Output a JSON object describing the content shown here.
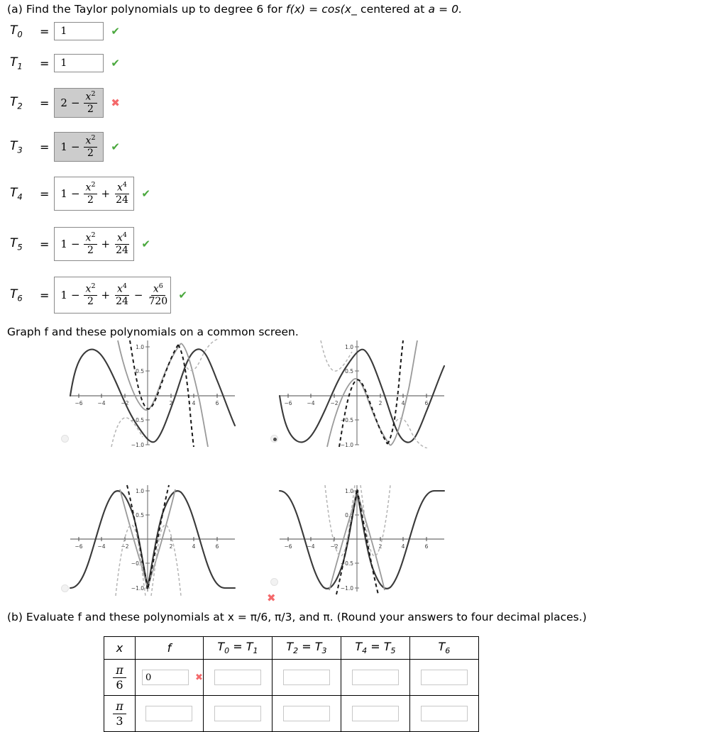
{
  "part_a": {
    "prompt": "(a) Find the Taylor polynomials up to degree 6 for  f(x) = cos(x_  centered at  a = 0.",
    "prompt_pieces": {
      "lead": "(a) Find the Taylor polynomials up to degree 6 for",
      "func": "f(x) = cos(x_",
      "center": "centered at",
      "a_value": "a = 0."
    },
    "rows": [
      {
        "label": "T",
        "sub": "0",
        "eq": "=",
        "value": "1",
        "kind": "plain",
        "box_state": "white",
        "mark": "correct",
        "mark_glyph": "✔"
      },
      {
        "label": "T",
        "sub": "1",
        "eq": "=",
        "value": "1",
        "kind": "plain",
        "box_state": "white",
        "mark": "correct",
        "mark_glyph": "✔"
      },
      {
        "label": "T",
        "sub": "2",
        "eq": "=",
        "value": "2 - x^2/2",
        "kind": "expr2",
        "lead_const": "2",
        "box_state": "gray",
        "mark": "incorrect",
        "mark_glyph": "✖"
      },
      {
        "label": "T",
        "sub": "3",
        "eq": "=",
        "value": "1 - x^2/2",
        "kind": "expr2",
        "lead_const": "1",
        "box_state": "gray",
        "mark": "correct",
        "mark_glyph": "✔"
      },
      {
        "label": "T",
        "sub": "4",
        "eq": "=",
        "value": "1 - x^2/2 + x^4/24",
        "kind": "expr4",
        "lead_const": "1",
        "box_state": "white",
        "mark": "correct",
        "mark_glyph": "✔"
      },
      {
        "label": "T",
        "sub": "5",
        "eq": "=",
        "value": "1 - x^2/2 + x^4/24",
        "kind": "expr4",
        "lead_const": "1",
        "box_state": "white",
        "mark": "correct",
        "mark_glyph": "✔"
      },
      {
        "label": "T",
        "sub": "6",
        "eq": "=",
        "value": "1 - x^2/2 + x^4/24 - x^6/720",
        "kind": "expr6",
        "lead_const": "1",
        "box_state": "white",
        "mark": "correct",
        "mark_glyph": "✔"
      }
    ],
    "terms": {
      "minus": "−",
      "plus": "+",
      "x": "x",
      "exp2": "2",
      "exp4": "4",
      "exp6": "6",
      "den2": "2",
      "den24": "24",
      "den720": "720"
    }
  },
  "graph_section": {
    "instruction": "Graph f and these polynomials on a common screen.",
    "options": [
      {
        "id": "graph-option-1",
        "selected": false,
        "mark": null,
        "curve": "sine"
      },
      {
        "id": "graph-option-2",
        "selected": true,
        "mark": null,
        "curve": "neg-sine"
      },
      {
        "id": "graph-option-3",
        "selected": false,
        "mark": null,
        "curve": "neg-cos-inverted"
      },
      {
        "id": "graph-option-4",
        "selected": false,
        "mark": "incorrect",
        "mark_glyph": "✖",
        "curve": "cos-shifted"
      }
    ],
    "axis": {
      "x_ticks": [
        "−6",
        "−4",
        "−2",
        "2",
        "4",
        "6"
      ],
      "y_ticks": [
        "1.0",
        "0.5",
        "−0.5",
        "−1.0"
      ],
      "xlim": [
        -6.6,
        6.6
      ],
      "ylim": [
        -1.15,
        1.15
      ]
    }
  },
  "part_b": {
    "prompt": "(b) Evaluate f and these polynomials at  x = π/6, π/3,  and π. (Round your answers to four decimal places.)",
    "table": {
      "headers": [
        {
          "text": "x",
          "sub": ""
        },
        {
          "text": "f",
          "sub": ""
        },
        {
          "text": "T",
          "sub": "0",
          "text2": " = T",
          "sub2": "1"
        },
        {
          "text": "T",
          "sub": "2",
          "text2": " = T",
          "sub2": "3"
        },
        {
          "text": "T",
          "sub": "4",
          "text2": " = T",
          "sub2": "5"
        },
        {
          "text": "T",
          "sub": "6",
          "text2": "",
          "sub2": ""
        }
      ],
      "rows": [
        {
          "x_num": "π",
          "x_den": "6",
          "cells": [
            {
              "value": "0",
              "mark": "incorrect",
              "mark_glyph": "✖"
            },
            {
              "value": "",
              "mark": null
            },
            {
              "value": "",
              "mark": null
            },
            {
              "value": "",
              "mark": null
            },
            {
              "value": "",
              "mark": null
            }
          ]
        },
        {
          "x_num": "π",
          "x_den": "3",
          "cells": [
            {
              "value": "",
              "mark": null
            },
            {
              "value": "",
              "mark": null
            },
            {
              "value": "",
              "mark": null
            },
            {
              "value": "",
              "mark": null
            },
            {
              "value": "",
              "mark": null
            }
          ]
        }
      ]
    }
  },
  "colors": {
    "correct": "#4aa83d",
    "incorrect": "#f4696b",
    "box_border": "#8a8a8a",
    "box_filled": "#cccccc",
    "table_border": "#000000",
    "input_border": "#c8c8c8",
    "curve_f": "#3a3a3a",
    "curve_gray": "#8f8f8f",
    "curve_dashed": "#1a1a1a"
  }
}
